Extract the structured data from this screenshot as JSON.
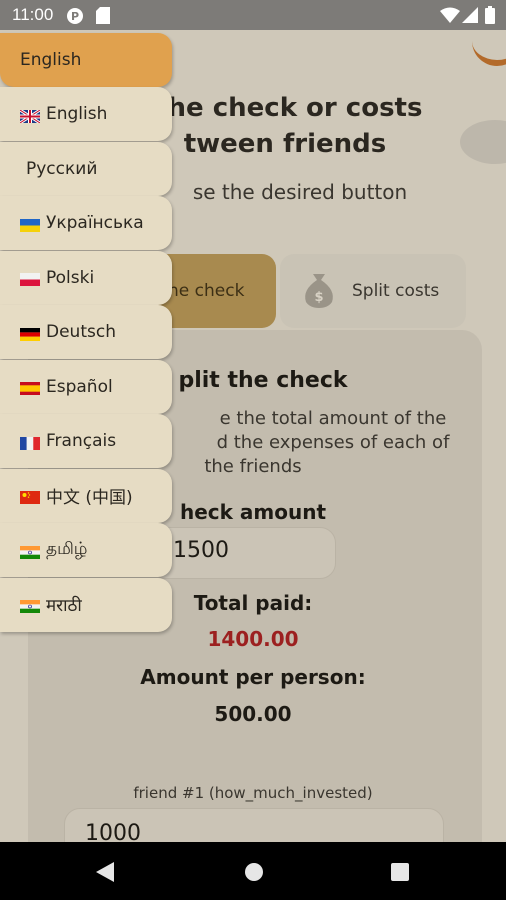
{
  "status_bar": {
    "time": "11:00"
  },
  "main": {
    "title_line1": "he check or costs",
    "title_line2": "tween friends",
    "subtitle": "se the desired button",
    "tabs": [
      {
        "label": "he check",
        "icon": "receipt-icon"
      },
      {
        "label": "Split costs",
        "icon": "money-bag-icon"
      }
    ],
    "card": {
      "heading": "plit the check",
      "desc_line1": "e the total amount of the",
      "desc_line2": "d the expenses of each of",
      "desc_line3": "the friends",
      "check_amount_label": "heck amount",
      "check_amount_value": "1500",
      "total_paid_label": "Total paid:",
      "total_paid_value": "1400.00",
      "per_person_label": "Amount per person:",
      "per_person_value": "500.00",
      "friend_label": "friend #1 (how_much_invested)",
      "friend_value": "1000"
    }
  },
  "language_menu": {
    "selected": "English",
    "items": [
      {
        "label": "English",
        "flag": "gb"
      },
      {
        "label": "Русский",
        "flag": "none"
      },
      {
        "label": "Українська",
        "flag": "ua"
      },
      {
        "label": "Polski",
        "flag": "pl"
      },
      {
        "label": "Deutsch",
        "flag": "de"
      },
      {
        "label": "Español",
        "flag": "es"
      },
      {
        "label": "Français",
        "flag": "fr"
      },
      {
        "label": "中文 (中国)",
        "flag": "cn"
      },
      {
        "label": "தமிழ்",
        "flag": "in"
      },
      {
        "label": "मराठी",
        "flag": "in"
      }
    ]
  },
  "colors": {
    "accent": "#e0a14e",
    "menu_bg": "#e6dcc4",
    "total_paid": "#9c2020"
  }
}
